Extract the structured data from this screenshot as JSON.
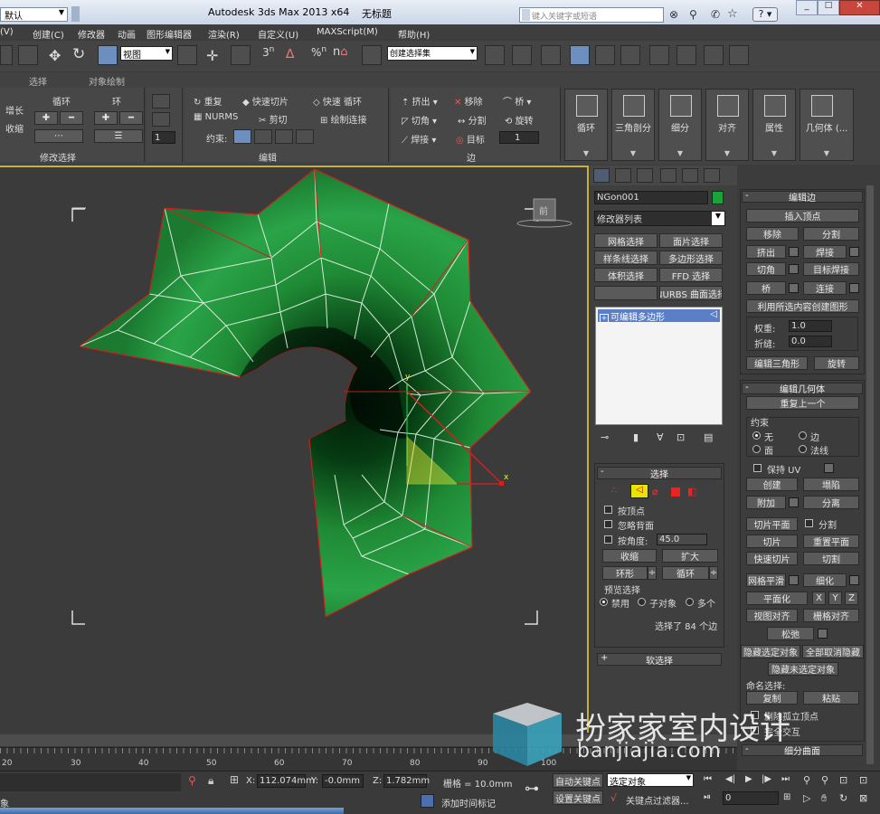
{
  "title_bar": {
    "workspace": "默认",
    "app_title": "Autodesk 3ds Max  2013 x64",
    "doc_title": "无标题",
    "search_placeholder": "键入关键字或短语"
  },
  "menu": [
    "(V)",
    "创建(C)",
    "修改器",
    "动画",
    "图形编辑器",
    "渲染(R)",
    "自定义(U)",
    "MAXScript(M)",
    "帮助(H)"
  ],
  "toolbar": {
    "view_dropdown": "视图",
    "selection_set": "创建选择集",
    "snap_3": "3",
    "snap_pct": "%",
    "snap_n": "n"
  },
  "ribbon": {
    "tabs": [
      "选择",
      "对象绘制"
    ],
    "modify_select": {
      "grow": "增长",
      "shrink": "收缩",
      "loop": "循环",
      "ring": "环",
      "label": "修改选择",
      "spinner": "1"
    },
    "edit": {
      "repeat": "重复",
      "quickslice": "快速切片",
      "quickloop": "快速 循环",
      "nurms": "NURMS",
      "cut": "剪切",
      "paint_connect": "绘制连接",
      "constraint": "约束:",
      "label": "编辑",
      "spinner": "1"
    },
    "edges": {
      "extrude": "挤出",
      "remove": "移除",
      "bridge": "桥",
      "chamfer": "切角",
      "split": "分割",
      "spin": "旋转",
      "weld": "焊接",
      "target": "目标",
      "label": "边",
      "spinner": "1"
    },
    "big_buttons": [
      "循环",
      "三角剖分",
      "细分",
      "对齐",
      "属性",
      "几何体 (..."
    ]
  },
  "viewport": {
    "axis_x": "x",
    "axis_y": "y",
    "cube_label": "前"
  },
  "cmd_panel": {
    "object_name": "NGon001",
    "object_color": "#1aa33a",
    "modifier_list": "修改器列表",
    "mod_buttons": [
      "网格选择",
      "面片选择",
      "样条线选择",
      "多边形选择",
      "体积选择",
      "FFD 选择",
      "",
      "NURBS 曲面选择"
    ],
    "stack_item": "可编辑多边形",
    "selection": {
      "header": "选择",
      "by_vertex": "按顶点",
      "ignore_backfacing": "忽略背面",
      "by_angle": "按角度:",
      "angle_value": "45.0",
      "shrink": "收缩",
      "grow": "扩大",
      "ring": "环形",
      "loop": "循环",
      "preview": "预览选择",
      "disabled": "禁用",
      "sub_object": "子对象",
      "multi": "多个",
      "status": "选择了 84 个边"
    },
    "soft_selection": "软选择"
  },
  "edit_panel": {
    "edit_edges": {
      "header": "编辑边",
      "insert_vertex": "插入顶点",
      "remove": "移除",
      "split": "分割",
      "extrude": "挤出",
      "weld": "焊接",
      "chamfer": "切角",
      "target_weld": "目标焊接",
      "bridge": "桥",
      "connect": "连接",
      "create_shape": "利用所选内容创建图形",
      "weight": "权重:",
      "weight_value": "1.0",
      "crease": "折缝:",
      "crease_value": "0.0",
      "edit_tri": "编辑三角形",
      "turn": "旋转"
    },
    "edit_geometry": {
      "header": "编辑几何体",
      "repeat_last": "重复上一个",
      "constraints": "约束",
      "none": "无",
      "edge": "边",
      "face": "面",
      "normal": "法线",
      "preserve_uv": "保持 UV",
      "create": "创建",
      "collapse": "塌陷",
      "attach": "附加",
      "detach": "分离",
      "slice_plane": "切片平面",
      "split": "分割",
      "slice": "切片",
      "reset_plane": "重置平面",
      "quickslice": "快速切片",
      "cut": "切割",
      "meshsmooth": "网格平滑",
      "refine": "细化",
      "planarize": "平面化",
      "x": "X",
      "y": "Y",
      "z": "Z",
      "view_align": "视图对齐",
      "grid_align": "栅格对齐",
      "relax": "松弛",
      "hide_selected": "隐藏选定对象",
      "unhide_all": "全部取消隐藏",
      "hide_unselected": "隐藏未选定对象",
      "named_sel": "命名选择:",
      "copy": "复制",
      "paste": "粘贴",
      "delete_iso": "删除孤立顶点",
      "full_interactivity": "完全交互"
    },
    "subdivide_surface": "细分曲面"
  },
  "timeline": {
    "ticks": [
      "20",
      "30",
      "40",
      "50",
      "60",
      "70",
      "80",
      "90",
      "100"
    ]
  },
  "status_bar": {
    "x_label": "X:",
    "x_value": "112.074mm",
    "y_label": "Y:",
    "y_value": "-0.0mm",
    "z_label": "Z:",
    "z_value": "1.782mm",
    "grid": "栅格 = 10.0mm",
    "add_time_tag": "添加时间标记",
    "autokey": "自动关键点",
    "set_key": "设置关键点",
    "selected_obj": "选定对象",
    "key_filter": "关键点过滤器...",
    "frame": "0",
    "left_status": "象"
  },
  "watermark": {
    "cn": "扮家家室内设计",
    "url": "banjiajia.com"
  }
}
